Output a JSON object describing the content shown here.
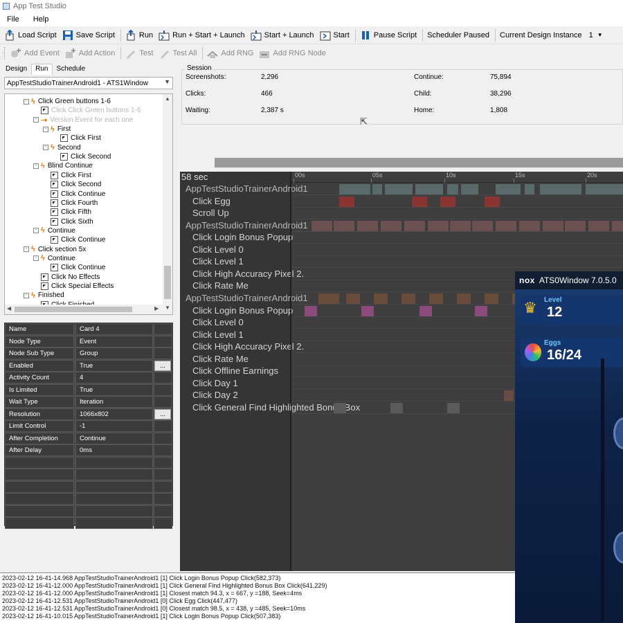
{
  "app": {
    "title": "App Test Studio"
  },
  "menu": [
    "File",
    "Help"
  ],
  "toolbar1": {
    "load_script": "Load Script",
    "save_script": "Save Script",
    "run": "Run",
    "run_start_launch": "Run + Start + Launch",
    "start_launch": "Start + Launch",
    "start": "Start",
    "pause_script": "Pause Script",
    "scheduler_status": "Scheduler Paused",
    "design_instance_label": "Current Design Instance",
    "design_instance_value": "1"
  },
  "toolbar2": {
    "add_event": "Add Event",
    "add_action": "Add Action",
    "test": "Test",
    "test_all": "Test All",
    "add_rng": "Add RNG",
    "add_rng_node": "Add RNG Node"
  },
  "tabs": [
    "Design",
    "Run",
    "Schedule"
  ],
  "window_select": "AppTestStudioTrainerAndroid1 - ATS1Window",
  "tree": [
    {
      "label": "Click Green buttons 1-6",
      "kind": "event",
      "indent": 0,
      "exp": "-"
    },
    {
      "label": "Click Click Green buttons 1-6",
      "kind": "action",
      "indent": 1,
      "dim": true
    },
    {
      "label": "Version Event for each one",
      "kind": "rng",
      "indent": 1,
      "dim": true,
      "exp": "-"
    },
    {
      "label": "First",
      "kind": "event",
      "indent": 2,
      "exp": "-"
    },
    {
      "label": "Click First",
      "kind": "action",
      "indent": 3
    },
    {
      "label": "Second",
      "kind": "event",
      "indent": 2,
      "exp": "-"
    },
    {
      "label": "Click Second",
      "kind": "action",
      "indent": 3
    },
    {
      "label": "Blind Continue",
      "kind": "event",
      "indent": 1,
      "exp": "-"
    },
    {
      "label": "Click First",
      "kind": "action",
      "indent": 2
    },
    {
      "label": "Click Second",
      "kind": "action",
      "indent": 2
    },
    {
      "label": "Click Continue",
      "kind": "action",
      "indent": 2
    },
    {
      "label": "Click Fourth",
      "kind": "action",
      "indent": 2
    },
    {
      "label": "Click Fifth",
      "kind": "action",
      "indent": 2
    },
    {
      "label": "Click Sixth",
      "kind": "action",
      "indent": 2
    },
    {
      "label": "Continue",
      "kind": "event",
      "indent": 1,
      "exp": "-"
    },
    {
      "label": "Click Continue",
      "kind": "action",
      "indent": 2
    },
    {
      "label": "Click section 5x",
      "kind": "event",
      "indent": 0,
      "exp": "-"
    },
    {
      "label": "Continue",
      "kind": "event",
      "indent": 1,
      "exp": "-"
    },
    {
      "label": "Click Continue",
      "kind": "action",
      "indent": 2
    },
    {
      "label": "Click No Effects",
      "kind": "action",
      "indent": 1
    },
    {
      "label": "Click Special Effects",
      "kind": "action",
      "indent": 1
    },
    {
      "label": "Finished",
      "kind": "event",
      "indent": 0,
      "exp": "-"
    },
    {
      "label": "Click Finished",
      "kind": "action",
      "indent": 1
    }
  ],
  "properties": [
    {
      "name": "Name",
      "value": "Card 4"
    },
    {
      "name": "Node Type",
      "value": "Event"
    },
    {
      "name": "Node Sub Type",
      "value": "Group"
    },
    {
      "name": "Enabled",
      "value": "True",
      "button": "..."
    },
    {
      "name": "Activity Count",
      "value": "4"
    },
    {
      "name": "Is Limited",
      "value": "True"
    },
    {
      "name": "Wait Type",
      "value": "Iteration"
    },
    {
      "name": "Resolution",
      "value": "1066x802",
      "button": "..."
    },
    {
      "name": "Limit Control",
      "value": "-1"
    },
    {
      "name": "After Completion",
      "value": "Continue"
    },
    {
      "name": "After Delay",
      "value": "0ms"
    },
    {
      "name": "",
      "value": ""
    },
    {
      "name": "",
      "value": ""
    },
    {
      "name": "",
      "value": ""
    },
    {
      "name": "",
      "value": ""
    },
    {
      "name": "",
      "value": ""
    },
    {
      "name": "",
      "value": ""
    }
  ],
  "session": {
    "legend": "Session",
    "screenshots_label": "Screenshots:",
    "screenshots": "2,296",
    "clicks_label": "Clicks:",
    "clicks": "466",
    "waiting_label": "Waiting:",
    "waiting": "2,387 s",
    "continue_label": "Continue:",
    "continue": "75,894",
    "child_label": "Child:",
    "child": "38,296",
    "home_label": "Home:",
    "home": "1,808"
  },
  "timeline": {
    "duration": "58 sec",
    "ticks": [
      "00s",
      "05s",
      "10s",
      "15s",
      "20s"
    ],
    "rows": [
      {
        "label": "AppTestStudioTrainerAndroid1",
        "group": true
      },
      {
        "label": "Click Egg"
      },
      {
        "label": "Scroll Up"
      },
      {
        "label": "AppTestStudioTrainerAndroid1",
        "group": true
      },
      {
        "label": "Click Login Bonus Popup"
      },
      {
        "label": "Click Level 0"
      },
      {
        "label": "Click Level 1"
      },
      {
        "label": "Click High Accuracy Pixel 2."
      },
      {
        "label": "Click Rate Me"
      },
      {
        "label": "AppTestStudioTrainerAndroid1",
        "group": true
      },
      {
        "label": "Click Login Bonus Popup"
      },
      {
        "label": "Click Level 0"
      },
      {
        "label": "Click Level 1"
      },
      {
        "label": "Click High Accuracy Pixel 2."
      },
      {
        "label": "Click Rate Me"
      },
      {
        "label": "Click Offline Earnings"
      },
      {
        "label": "Click Day 1"
      },
      {
        "label": "Click Day 2"
      },
      {
        "label": "Click General Find Highlighted Bonus Box"
      }
    ]
  },
  "nox": {
    "brand": "nox",
    "title": "ATS0Window 7.0.5.0",
    "level_label": "Level",
    "level_value": "12",
    "eggs_label": "Eggs",
    "eggs_value": "16/24"
  },
  "log": [
    "2023-02-12 16-41-14.968 AppTestStudioTrainerAndroid1 [1] Click Login Bonus Popup Click(582,373)",
    "2023-02-12 16-41-12.000 AppTestStudioTrainerAndroid1 [1] Click General Find Highlighted Bonus Box Click(641,229)",
    "2023-02-12 16-41-12.000 AppTestStudioTrainerAndroid1 [1] Closest match 94.3, x = 667,  y =188, Seek=4ms",
    "2023-02-12 16-41-12.531 AppTestStudioTrainerAndroid1 [0] Click Egg Click(447,477)",
    "2023-02-12 16-41-12.531 AppTestStudioTrainerAndroid1 [0] Closest match 98.5, x = 438,  y =485, Seek=10ms",
    "2023-02-12 16-41-10.015 AppTestStudioTrainerAndroid1 [1] Click Login Bonus Popup Click(507,383)"
  ]
}
